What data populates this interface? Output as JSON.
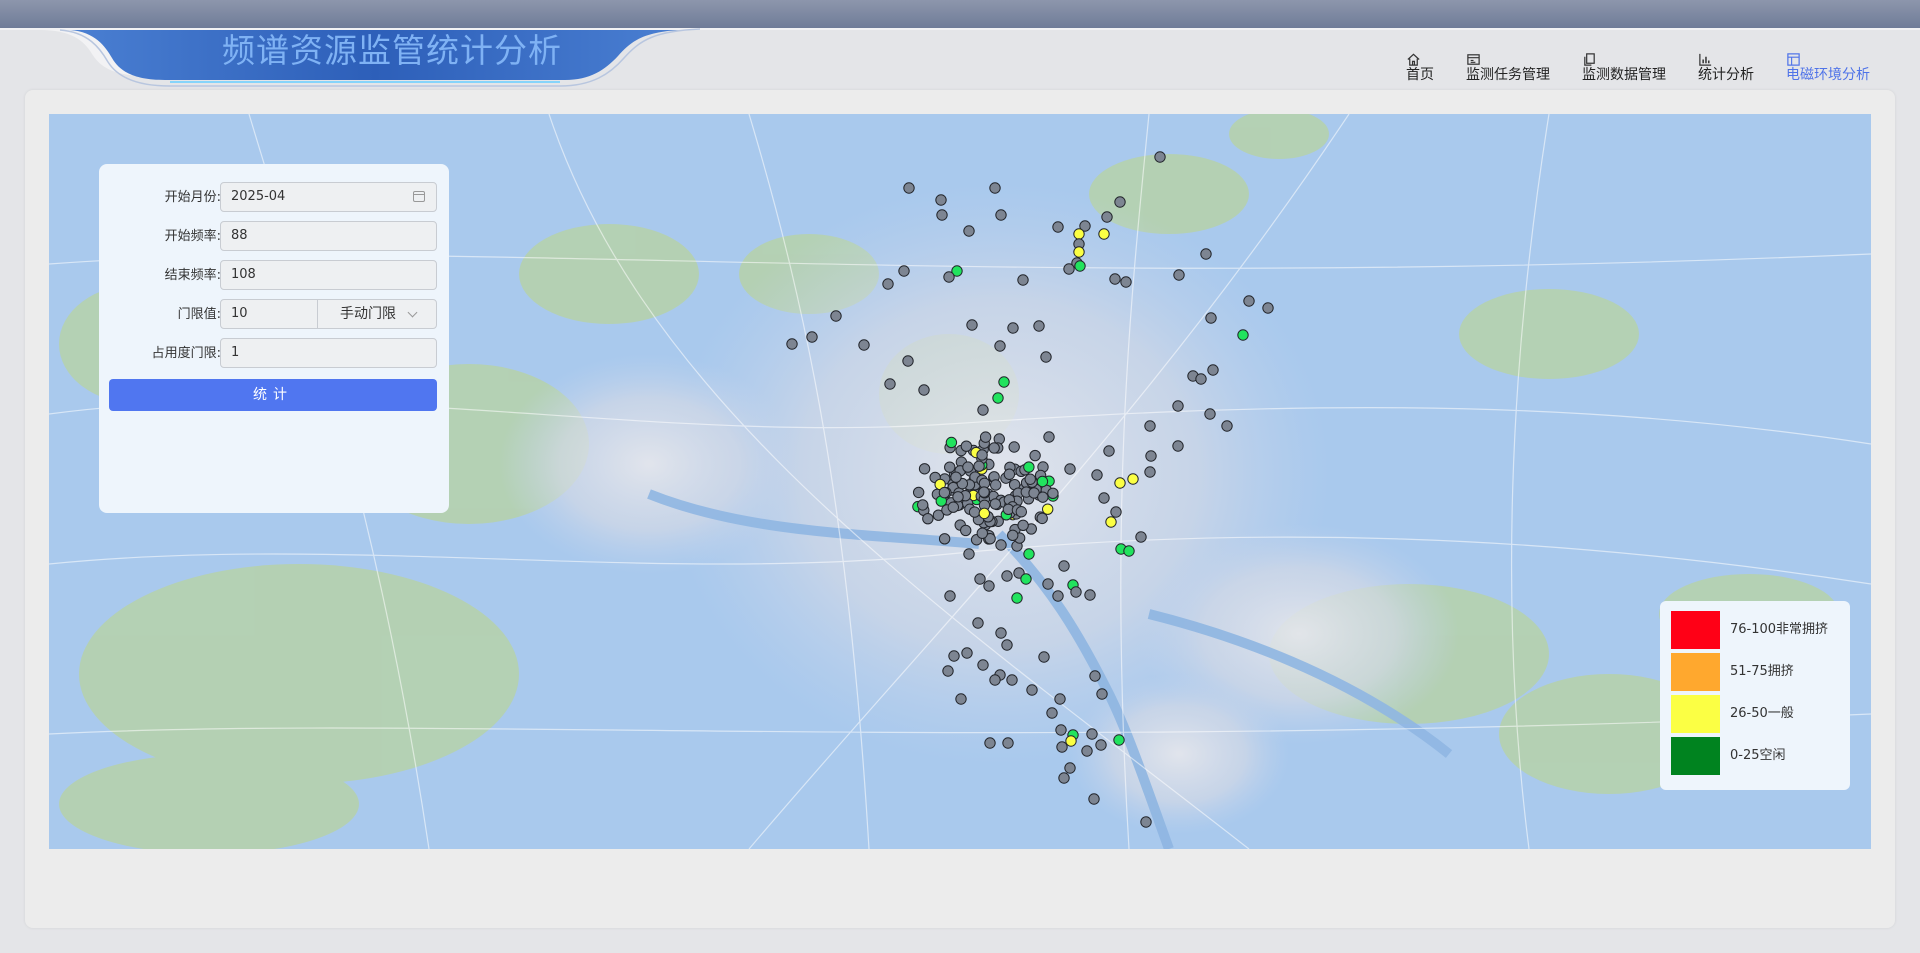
{
  "header": {
    "title": "频谱资源监管统计分析",
    "nav": [
      {
        "label": "首页",
        "icon": "home-icon",
        "active": false
      },
      {
        "label": "监测任务管理",
        "icon": "task-icon",
        "active": false
      },
      {
        "label": "监测数据管理",
        "icon": "data-icon",
        "active": false
      },
      {
        "label": "统计分析",
        "icon": "bar-chart-icon",
        "active": false
      },
      {
        "label": "电磁环境分析",
        "icon": "window-icon",
        "active": true
      }
    ],
    "accent_color": "#4f73e8"
  },
  "form": {
    "start_month_label": "开始月份:",
    "start_month_value": "2025-04",
    "start_freq_label": "开始频率:",
    "start_freq_value": "88",
    "end_freq_label": "结束频率:",
    "end_freq_value": "108",
    "threshold_label": "门限值:",
    "threshold_value": "10",
    "threshold_mode": "手动门限",
    "occupancy_label": "占用度门限:",
    "occupancy_value": "1",
    "submit_label": "统计",
    "submit_color": "#5076f0"
  },
  "legend": {
    "items": [
      {
        "label": "76-100非常拥挤",
        "color": "#ff0016"
      },
      {
        "label": "51-75拥挤",
        "color": "#ffa82e"
      },
      {
        "label": "26-50一般",
        "color": "#fbff44"
      },
      {
        "label": "0-25空闲",
        "color": "#00831f"
      }
    ]
  },
  "map": {
    "marker_colors": {
      "gray": "#7d8592",
      "green": "#21e35e",
      "yellow": "#fbff44"
    }
  }
}
